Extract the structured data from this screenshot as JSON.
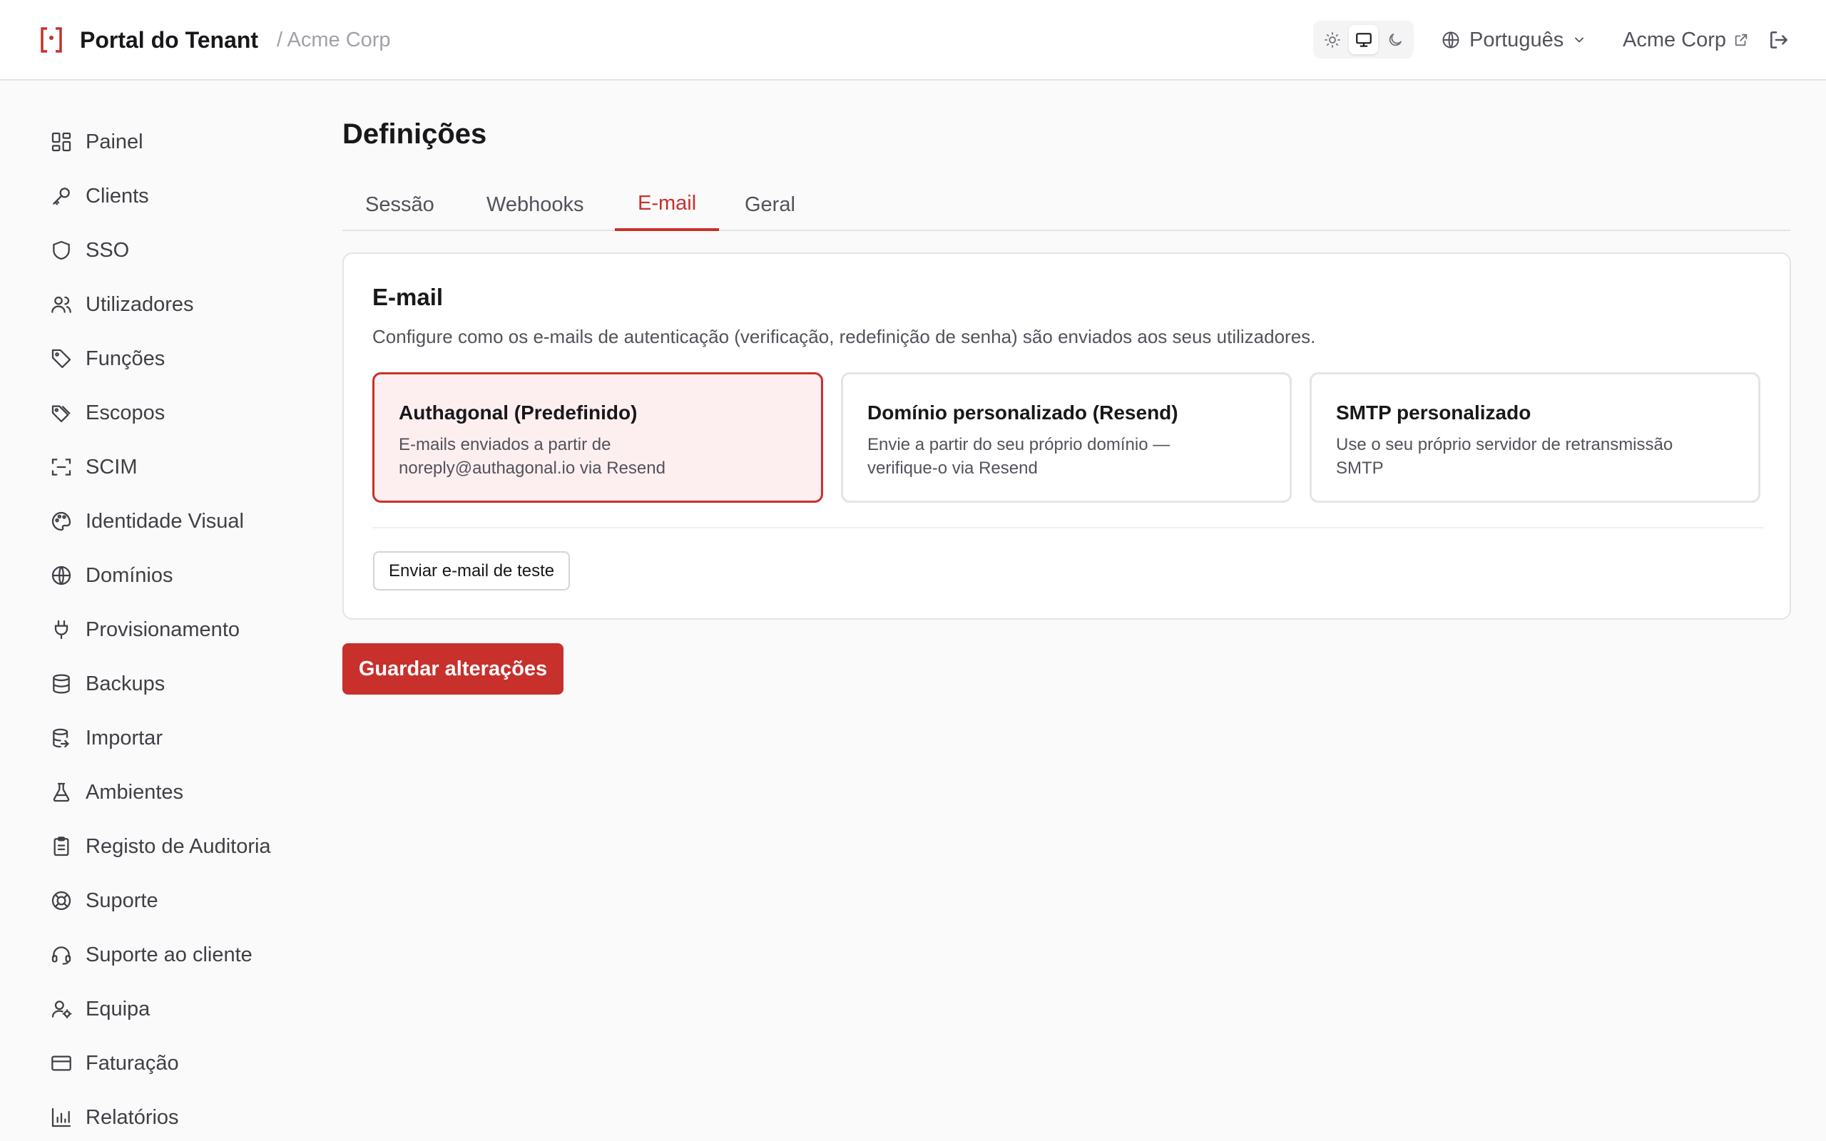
{
  "brand": {
    "title": "Portal do Tenant",
    "tenant": "/ Acme Corp",
    "logo_icon": "bracket-dot-logo"
  },
  "header": {
    "theme_modes": [
      "light",
      "system",
      "dark"
    ],
    "theme_selected": "system",
    "language": "Português",
    "tenant_link": "Acme Corp"
  },
  "sidebar": {
    "items": [
      {
        "label": "Painel",
        "icon": "dashboard-icon"
      },
      {
        "label": "Clients",
        "icon": "key-icon"
      },
      {
        "label": "SSO",
        "icon": "shield-icon"
      },
      {
        "label": "Utilizadores",
        "icon": "users-icon"
      },
      {
        "label": "Funções",
        "icon": "tag-icon"
      },
      {
        "label": "Escopos",
        "icon": "tags-icon"
      },
      {
        "label": "SCIM",
        "icon": "scan-icon"
      },
      {
        "label": "Identidade Visual",
        "icon": "palette-icon"
      },
      {
        "label": "Domínios",
        "icon": "globe-icon"
      },
      {
        "label": "Provisionamento",
        "icon": "plug-icon"
      },
      {
        "label": "Backups",
        "icon": "database-icon"
      },
      {
        "label": "Importar",
        "icon": "database-import-icon"
      },
      {
        "label": "Ambientes",
        "icon": "flask-icon"
      },
      {
        "label": "Registo de Auditoria",
        "icon": "clipboard-icon"
      },
      {
        "label": "Suporte",
        "icon": "lifebuoy-icon"
      },
      {
        "label": "Suporte ao cliente",
        "icon": "headset-icon"
      },
      {
        "label": "Equipa",
        "icon": "user-cog-icon"
      },
      {
        "label": "Faturação",
        "icon": "credit-card-icon"
      },
      {
        "label": "Relatórios",
        "icon": "bar-chart-icon"
      }
    ]
  },
  "main": {
    "title": "Definições",
    "tabs": [
      "Sessão",
      "Webhooks",
      "E-mail",
      "Geral"
    ],
    "active_tab": "E-mail",
    "card": {
      "title": "E-mail",
      "description": "Configure como os e-mails de autenticação (verificação, redefinição de senha) são enviados aos seus utilizadores.",
      "options": [
        {
          "title": "Authagonal (Predefinido)",
          "line1": "E-mails enviados a partir de",
          "line2": "noreply@authagonal.io via Resend",
          "selected": true
        },
        {
          "title": "Domínio personalizado (Resend)",
          "line1": "Envie a partir do seu próprio domínio —",
          "line2": "verifique-o via Resend",
          "selected": false
        },
        {
          "title": "SMTP personalizado",
          "line1": "Use o seu próprio servidor de retransmissão",
          "line2": "SMTP",
          "selected": false
        }
      ],
      "test_button": "Enviar e-mail de teste"
    },
    "save_button": "Guardar alterações"
  },
  "colors": {
    "accent": "#c8302c",
    "selected_bg": "#fdeff0",
    "border": "#e4e4e7",
    "text": "#18181b",
    "muted": "#52525b"
  }
}
